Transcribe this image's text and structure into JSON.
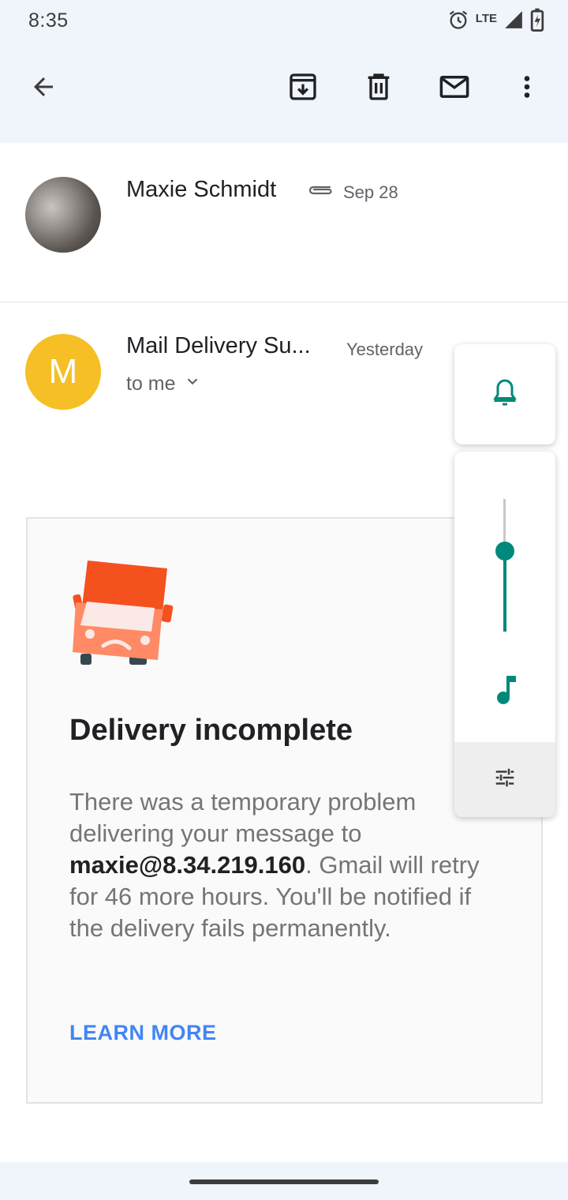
{
  "status_bar": {
    "time": "8:35",
    "network": "LTE",
    "icons": [
      "alarm-icon",
      "lte-signal-icon",
      "battery-charging-icon"
    ]
  },
  "toolbar": {
    "icons": [
      "back-arrow-icon",
      "archive-icon",
      "delete-icon",
      "mark-unread-icon",
      "more-vert-icon"
    ]
  },
  "thread": [
    {
      "sender": "Maxie Schmidt",
      "has_attachment": true,
      "date": "Sep 28"
    },
    {
      "avatar_letter": "M",
      "sender": "Mail Delivery Su...",
      "date": "Yesterday",
      "recipient": "to me"
    }
  ],
  "message": {
    "title": "Delivery incomplete",
    "body_before": "There was a temporary problem delivering your message to ",
    "body_email": "maxie@8.34.219.160",
    "body_after": ". Gmail will retry for 46 more hours. You'll be notified if the delivery fails permanently.",
    "link_label": "LEARN MORE"
  },
  "volume_panel": {
    "ringer_icon": "bell-icon",
    "media_icon": "music-note-icon",
    "settings_icon": "tune-icon",
    "media_level": 0.6
  },
  "colors": {
    "bar_bg": "#f0f4fb",
    "avatar_m": "#f6bf26",
    "accent_teal": "#00897b",
    "link_blue": "#4285f4",
    "truck_orange": "#f4511e"
  }
}
